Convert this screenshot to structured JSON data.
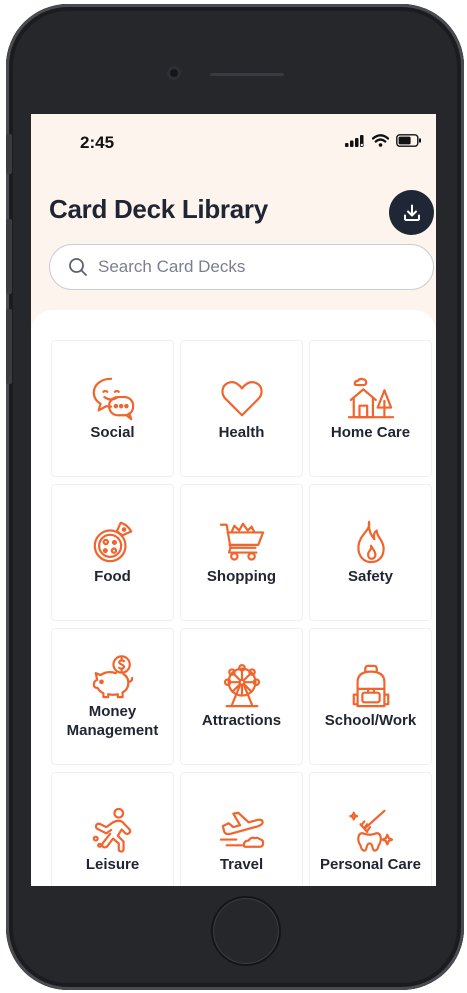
{
  "status_bar": {
    "time": "2:45"
  },
  "header": {
    "title": "Card Deck Library",
    "download_icon": "download-icon"
  },
  "search": {
    "placeholder": "Search Card Decks",
    "value": ""
  },
  "colors": {
    "accent": "#f0652e",
    "title": "#1f2533",
    "button": "#1f2736",
    "header_bg": "#fdf4ee"
  },
  "categories": [
    {
      "label": "Social",
      "icon": "chat-bubbles-icon"
    },
    {
      "label": "Health",
      "icon": "heart-icon"
    },
    {
      "label": "Home Care",
      "icon": "house-icon"
    },
    {
      "label": "Food",
      "icon": "pizza-icon"
    },
    {
      "label": "Shopping",
      "icon": "shopping-cart-icon"
    },
    {
      "label": "Safety",
      "icon": "flame-icon"
    },
    {
      "label": "Money Management",
      "icon": "piggy-bank-icon"
    },
    {
      "label": "Attractions",
      "icon": "ferris-wheel-icon"
    },
    {
      "label": "School/Work",
      "icon": "backpack-icon"
    },
    {
      "label": "Leisure",
      "icon": "running-person-icon"
    },
    {
      "label": "Travel",
      "icon": "airplane-icon"
    },
    {
      "label": "Personal Care",
      "icon": "tooth-brush-icon"
    }
  ]
}
